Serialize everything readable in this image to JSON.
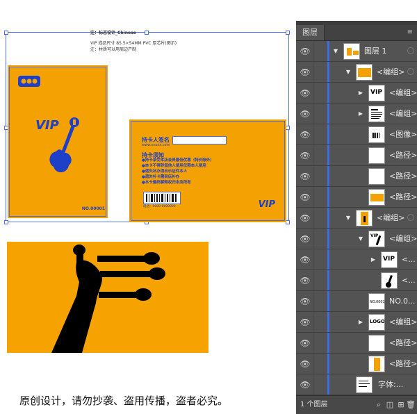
{
  "artboard": {
    "notes": [
      "注：标志设计_Chinese",
      "VIP 成品尺寸 85.5×54MM PVC 厚芯片(图示)",
      "注：材质可以用周边产制"
    ],
    "front": {
      "logo": "LOGO",
      "vip": "VIP",
      "card_no": "NO.00001"
    },
    "back": {
      "holder_label": "持卡人签名",
      "url": "www.xxxxx.com",
      "rules_title": "持卡须知",
      "rules": [
        "●持卡享受本店会员最低优惠（特价除外）",
        "●本卡不得转借他人使用仅限本人使用",
        "●遗失补办须出示证件本人",
        "●遗失补卡需到店补办",
        "●本卡最终解释权归本店所有"
      ],
      "barcode_text": "电话：0000-0000000",
      "vip": "VIP"
    },
    "caption": "原创设计，请勿抄袭、盗用传播，盗者必究。"
  },
  "colors": {
    "card_orange": "#f4a103",
    "selection_blue": "#4a6cf0",
    "panel_bg": "#535353"
  },
  "layers_panel": {
    "tab": "图层",
    "rows": [
      {
        "label": "图层 1",
        "thumb": "layer"
      },
      {
        "label": "<编组>",
        "thumb": "group-card"
      },
      {
        "label": "<编组>",
        "thumb": "vip-text"
      },
      {
        "label": "<编组>",
        "thumb": "text-lines"
      },
      {
        "label": "<图像>",
        "thumb": "image"
      },
      {
        "label": "<路径>",
        "thumb": "white"
      },
      {
        "label": "<路径>",
        "thumb": "white"
      },
      {
        "label": "<路径>",
        "thumb": "orange"
      },
      {
        "label": "<编组>",
        "thumb": "group-front"
      },
      {
        "label": "<编组>",
        "thumb": "vip-guitar"
      },
      {
        "label": "<...",
        "thumb": "vip-text"
      },
      {
        "label": "<...",
        "thumb": "guitar"
      },
      {
        "label": "NO.0...",
        "thumb": "no-text"
      },
      {
        "label": "<编组>",
        "thumb": "logo"
      },
      {
        "label": "<路径>",
        "thumb": "white"
      },
      {
        "label": "<路径>",
        "thumb": "orange-strip"
      },
      {
        "label": "字体:...",
        "thumb": "text-lines"
      }
    ],
    "footer": "1 个图层"
  }
}
